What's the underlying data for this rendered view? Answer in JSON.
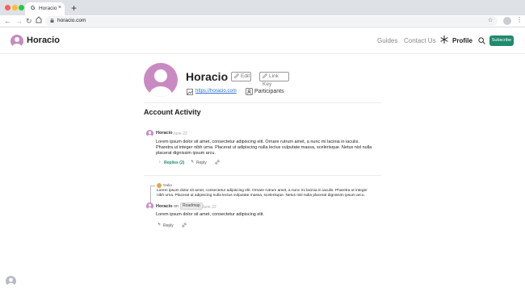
{
  "browser": {
    "tab_title": "Horacio",
    "tab_favicon": "G",
    "tab_close": "×",
    "new_tab": "+",
    "url": "horacio.com",
    "icons": [
      "back-arrow-icon",
      "forward-arrow-icon",
      "reload-icon",
      "home-icon",
      "lock-icon",
      "star-icon",
      "profile-icon",
      "kebab-menu-icon"
    ]
  },
  "header": {
    "brand": "Horacio",
    "nav": {
      "guides": "Guides",
      "contact": "Contact Us",
      "profile": "Profile"
    },
    "subscribe": "Subscribe",
    "accent": "#1f8a6e"
  },
  "profile": {
    "name": "Horacio",
    "edit": "Edit",
    "link_key": "Link Key",
    "url": "https://horacio.com",
    "participants": "Participants",
    "avatar_color": "#c88ac0"
  },
  "activity": {
    "title": "Account Activity",
    "comments": [
      {
        "author": "Horacio",
        "date": "June 22",
        "body": "Lorem ipsum dolor sit amet, consectetur adipiscing elit. Ornare rutrum amet, a nunc mi lacinia in iaculis. Pharetra ut integer nibh urna. Placerat ut adipiscing nulla lectus vulputate massa, scelerisque. Netus nisl nulla placerat dignissim ipsum arcu.",
        "replies": "Replies (2)",
        "reply": "Reply"
      },
      {
        "quote_author": "Gabo",
        "quote_body": "Lorem ipsum dolor sit amet, consectetur adipiscing elit. Ornare rutrum amet, a nunc mi lacinia in iaculis. Pharetra ut integer nibh urna. Placerat ut adipiscing nulla lectus vulputate massa, scelerisque. Netus nisl nulla placerat dignissim ipsum arcu.",
        "author": "Horacio",
        "on": "on",
        "tag": "Roadmap",
        "date": "June 22",
        "body": "Lorem ipsum dolor sit amet, consectetur adipiscing elit.",
        "reply": "Reply"
      }
    ]
  }
}
